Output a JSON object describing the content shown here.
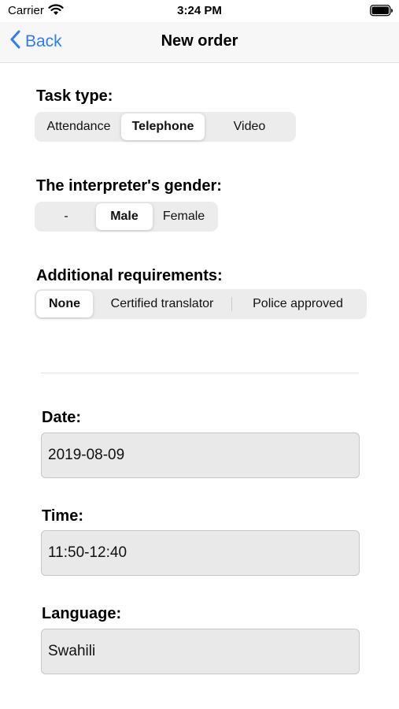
{
  "status_bar": {
    "carrier": "Carrier",
    "time": "3:24 PM"
  },
  "nav": {
    "back_label": "Back",
    "title": "New order"
  },
  "task_type": {
    "label": "Task type:",
    "options": [
      "Attendance",
      "Telephone",
      "Video"
    ],
    "selected": "Telephone"
  },
  "gender": {
    "label": "The interpreter's gender:",
    "options": [
      "-",
      "Male",
      "Female"
    ],
    "selected": "Male"
  },
  "requirements": {
    "label": "Additional requirements:",
    "options": [
      "None",
      "Certified translator",
      "Police approved"
    ],
    "selected": "None"
  },
  "fields": {
    "date": {
      "label": "Date:",
      "value": "2019-08-09"
    },
    "time": {
      "label": "Time:",
      "value": "11:50-12:40"
    },
    "language": {
      "label": "Language:",
      "value": "Swahili"
    }
  },
  "colors": {
    "accent": "#2f7cf6",
    "segment_bg": "#ececec",
    "input_bg": "#e9e9e9"
  }
}
